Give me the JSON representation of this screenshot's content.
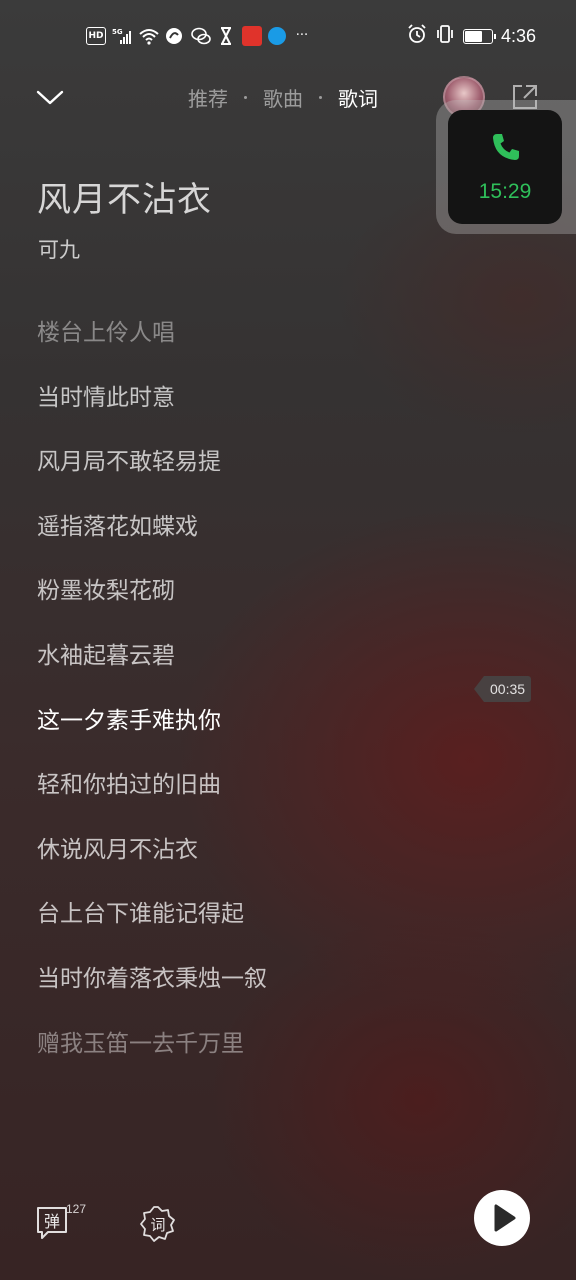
{
  "status_bar": {
    "left_icons": [
      "hd-icon",
      "signal-5g-icon",
      "wifi-icon",
      "app-icon",
      "wechat-icon",
      "hourglass-icon",
      "app-red-icon",
      "app-blue-icon",
      "more-icon"
    ],
    "hd_label": "HD",
    "net_label": "5G",
    "more_label": "···",
    "time": "4:36",
    "battery_level": 0.65
  },
  "nav": {
    "tabs": [
      {
        "label": "推荐",
        "active": false
      },
      {
        "label": "歌曲",
        "active": false
      },
      {
        "label": "歌词",
        "active": true
      }
    ]
  },
  "call_widget": {
    "time": "15:29",
    "accent": "#2fbf5a"
  },
  "song": {
    "title": "风月不沾衣",
    "artist": "可九"
  },
  "lyrics": [
    {
      "text": "楼台上伶人唱",
      "state": "dim"
    },
    {
      "text": "当时情此时意",
      "state": "normal"
    },
    {
      "text": "风月局不敢轻易提",
      "state": "normal"
    },
    {
      "text": "遥指落花如蝶戏",
      "state": "normal"
    },
    {
      "text": "粉墨妆梨花砌",
      "state": "normal"
    },
    {
      "text": "水袖起暮云碧",
      "state": "normal"
    },
    {
      "text": "这一夕素手难执你",
      "state": "current"
    },
    {
      "text": "轻和你拍过的旧曲",
      "state": "normal"
    },
    {
      "text": "休说风月不沾衣",
      "state": "normal"
    },
    {
      "text": "台上台下谁能记得起",
      "state": "normal"
    },
    {
      "text": "当时你着落衣秉烛一叙",
      "state": "normal"
    },
    {
      "text": "赠我玉笛一去千万里",
      "state": "dim"
    }
  ],
  "time_marker": "00:35",
  "bottom": {
    "danmu_label": "弹",
    "danmu_count": "127",
    "lyric_label": "词"
  }
}
